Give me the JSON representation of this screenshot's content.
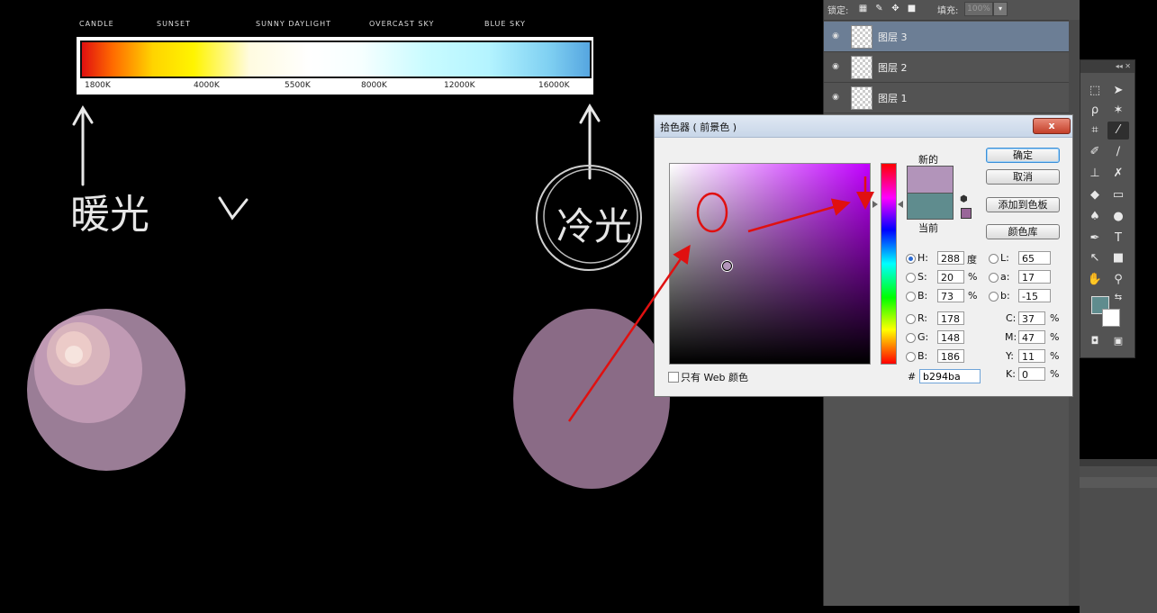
{
  "canvas": {
    "temperature_labels": [
      "CANDLE",
      "SUNSET",
      "SUNNY DAYLIGHT",
      "OVERCAST SKY",
      "BLUE SKY"
    ],
    "temperature_ticks": [
      "1800K",
      "4000K",
      "5500K",
      "8000K",
      "12000K",
      "16000K"
    ],
    "handwritten_left": "暖光",
    "handwritten_right": "冷光",
    "colors": {
      "left_sphere": "#9a7d96",
      "left_highlight": "#e7c3c4",
      "right_sphere": "#8a6b86",
      "annotation_red": "#e01010"
    }
  },
  "layers_panel": {
    "lock_label": "锁定:",
    "fill_label": "填充:",
    "fill_value": "100%",
    "layers": [
      {
        "name": "图层 3",
        "selected": true
      },
      {
        "name": "图层 2",
        "selected": false
      },
      {
        "name": "图层 1",
        "selected": false
      }
    ]
  },
  "toolbar": {
    "collapse": "◂◂ ✕",
    "tools": [
      "marquee-icon",
      "move-icon",
      "lasso-icon",
      "magic-wand-icon",
      "crop-icon",
      "eyedropper-icon",
      "healing-icon",
      "brush-icon",
      "stamp-icon",
      "history-brush-icon",
      "eraser-icon",
      "gradient-icon",
      "blur-icon",
      "dodge-icon",
      "pen-icon",
      "type-icon",
      "path-select-icon",
      "shape-icon",
      "hand-icon",
      "zoom-icon"
    ],
    "foreground_color": "#5f8c8e",
    "background_color": "#ffffff"
  },
  "color_picker": {
    "title": "拾色器 ( 前景色 )",
    "close": "x",
    "new_label": "新的",
    "current_label": "当前",
    "new_color": "#b294ba",
    "current_color": "#5f8c8e",
    "buttons": {
      "ok": "确定",
      "cancel": "取消",
      "add_swatch": "添加到色板",
      "color_library": "颜色库"
    },
    "hsb": {
      "h_label": "H:",
      "h": "288",
      "h_unit": "度",
      "s_label": "S:",
      "s": "20",
      "s_unit": "%",
      "b_label": "B:",
      "b": "73",
      "b_unit": "%"
    },
    "lab": {
      "l_label": "L:",
      "l": "65",
      "a_label": "a:",
      "a": "17",
      "b_label": "b:",
      "b": "-15"
    },
    "rgb": {
      "r_label": "R:",
      "r": "178",
      "g_label": "G:",
      "g": "148",
      "b_label": "B:",
      "b": "186"
    },
    "cmyk": {
      "c_label": "C:",
      "c": "37",
      "m_label": "M:",
      "m": "47",
      "y_label": "Y:",
      "y": "11",
      "k_label": "K:",
      "k": "0",
      "unit": "%"
    },
    "hex_label": "#",
    "hex": "b294ba",
    "web_only": "只有 Web 颜色"
  }
}
